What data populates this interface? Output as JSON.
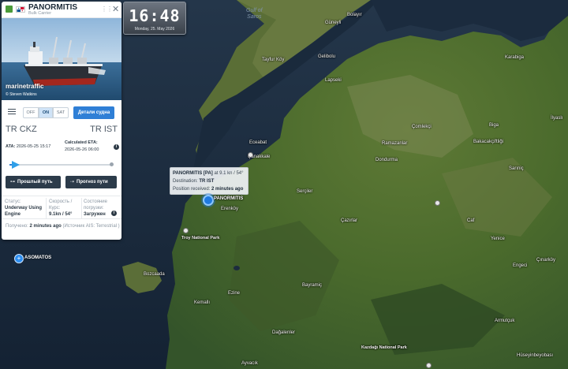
{
  "clock": {
    "time": "16:48",
    "date": "Monday, 25. May 2026"
  },
  "vessel": {
    "name": "PANORMITIS",
    "type": "Bulk Carrier",
    "photo_brand": "marinetraffic",
    "photo_credit": "© Steven Watkins"
  },
  "toolbar": {
    "off": "OFF",
    "on": "ON",
    "sat": "SAT",
    "details": "Детали судна"
  },
  "route": {
    "from_code": "TR",
    "from_port": "CKZ",
    "to_code": "TR",
    "to_port": "IST"
  },
  "times": {
    "ata_label": "ATA:",
    "ata_value": "2026-05-25 15:17",
    "eta_label": "Calculated ETA:",
    "eta_value": "2026-05-26 06:00"
  },
  "progress": {
    "fraction": 0.02
  },
  "buttons": {
    "past_track": "Прошлый путь",
    "forecast": "Прогноз пути"
  },
  "stats": {
    "status_label": "Статус:",
    "status_value": "Underway Using Engine",
    "speed_label": "Скорость / Курс:",
    "speed_value": "9.1kn / 54°",
    "load_label": "Состояние погрузки:",
    "load_value": "Загружен"
  },
  "received": {
    "label": "Получено:",
    "value": "2 minutes ago",
    "source": "(Источник AIS: Terrestrial )"
  },
  "popup": {
    "title": "PANORMITIS [PA]",
    "speed_text": "at 9.1 kn / 54°",
    "dest_label": "Destination:",
    "dest_value": "TR IST",
    "pos_label": "Position received:",
    "pos_value": "2 minutes ago"
  },
  "markers": {
    "vessel_label": "PANORMITIS",
    "other_label": "ASOMATOS"
  },
  "places": {
    "gulf": "Gulf of\nSaros",
    "bolayir": "Bolayır",
    "guneyli": "Güneyli",
    "tayfurkoy": "Tayfur Köy",
    "gelibolu": "Gelibolu",
    "karabiga": "Karabiga",
    "lapseki": "Lapseki",
    "comlekci": "Çomlekçi",
    "biga": "Biga",
    "ilyasli": "İlyaslı",
    "ramazanlar": "Ramazanlar",
    "bakacakcif": "Bakacakçiftliği",
    "eceabat": "Eceabat",
    "canakkale": "Çanakkale",
    "dondurma": "Dondurma",
    "sariniç": "Sarıniç",
    "sercier": "Serçiler",
    "erenkoy": "Erenköy",
    "caf": "Caf",
    "cazirlar": "Çazırlar",
    "troy": "Troy National Park",
    "yenice": "Yenice",
    "cinarkoy": "Çınarköy",
    "bozcaada": "Bozcaada",
    "engeci": "Engeci",
    "bayramic": "Bayramiç",
    "kemalli": "Kemallı",
    "ezine": "Ezine",
    "armutcuk": "Armutçuk",
    "dagalenler": "Dağalenler",
    "kazdagi": "Kazdağı National Park",
    "huseyin": "Hüseyinbeyobası",
    "ayvacik": "Ayvacık"
  }
}
